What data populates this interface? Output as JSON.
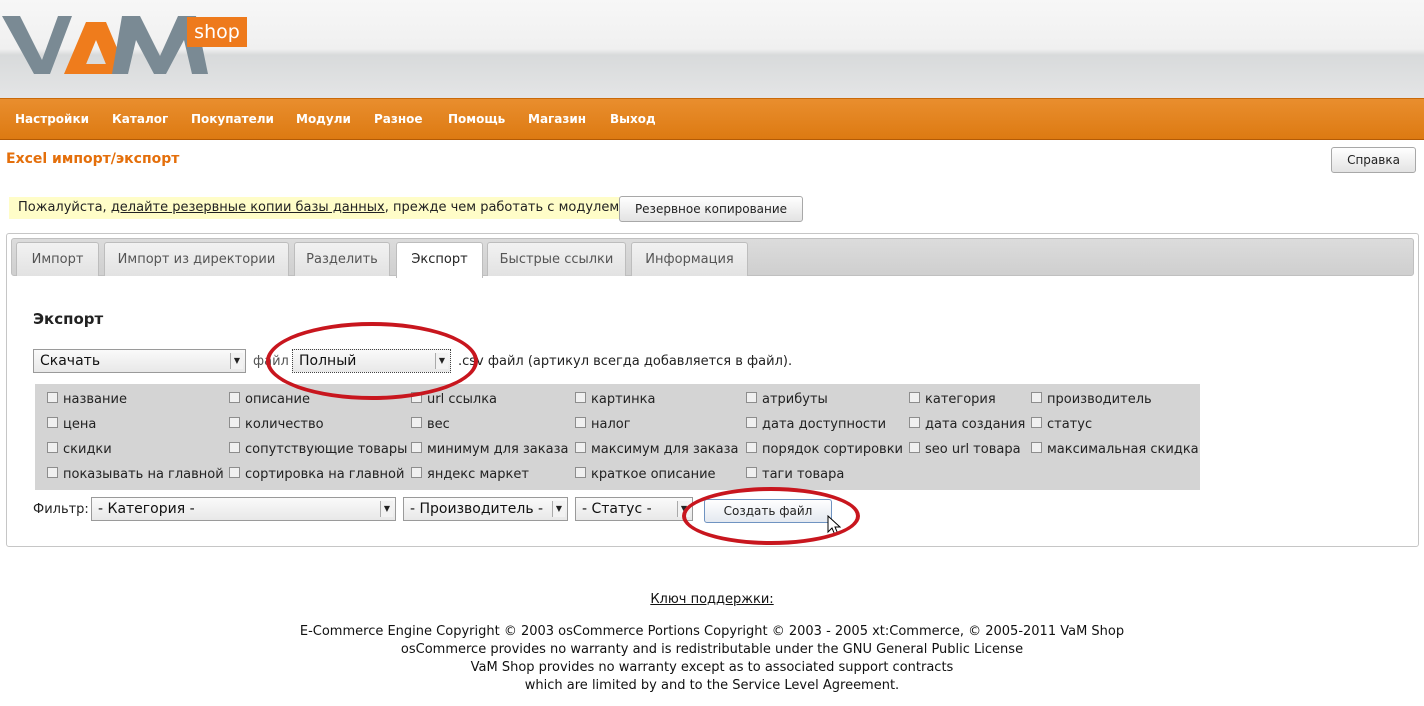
{
  "header": {
    "logo_text": "VaM",
    "logo_badge": "shop"
  },
  "nav": {
    "items": [
      {
        "label": "Настройки"
      },
      {
        "label": "Каталог"
      },
      {
        "label": "Покупатели"
      },
      {
        "label": "Модули"
      },
      {
        "label": "Разное"
      },
      {
        "label": "Помощь"
      },
      {
        "label": "Магазин"
      },
      {
        "label": "Выход"
      }
    ]
  },
  "page": {
    "title": "Excel импорт/экспорт",
    "help_label": "Справка"
  },
  "warning": {
    "prefix": "Пожалуйста, ",
    "link": "делайте резервные копии базы данных",
    "suffix": ", прежде чем работать с модулем!",
    "backup_button": "Резервное копирование"
  },
  "tabs": [
    {
      "label": "Импорт"
    },
    {
      "label": "Импорт из директории"
    },
    {
      "label": "Разделить"
    },
    {
      "label": "Экспорт",
      "active": true
    },
    {
      "label": "Быстрые ссылки"
    },
    {
      "label": "Информация"
    }
  ],
  "export": {
    "title": "Экспорт",
    "action_select": "Скачать",
    "file_word": "файл",
    "mode_select": "Полный",
    "mode_suffix": ".csv файл (артикул всегда добавляется в файл).",
    "fields": [
      "название",
      "описание",
      "url ссылка",
      "картинка",
      "атрибуты",
      "категория",
      "производитель",
      "цена",
      "количество",
      "вес",
      "налог",
      "дата доступности",
      "дата создания",
      "статус",
      "скидки",
      "сопутствующие товары",
      "минимум для заказа",
      "максимум для заказа",
      "порядок сортировки",
      "seo url товара",
      "максимальная скидка",
      "показывать на главной",
      "сортировка на главной",
      "яндекс маркет",
      "краткое описание",
      "таги товара"
    ],
    "filter_label": "Фильтр:",
    "filter_category": "- Категория -",
    "filter_manufacturer": "- Производитель -",
    "filter_status": "- Статус -",
    "create_button": "Создать файл"
  },
  "footer": {
    "support_key": "Ключ поддержки:",
    "line1": "E-Commerce Engine Copyright © 2003 osCommerce Portions Copyright © 2003 - 2005 xt:Commerce, © 2005-2011 VaM Shop",
    "line2": "osCommerce provides no warranty and is redistributable under the GNU General Public License",
    "line3": "VaM Shop provides no warranty except as to associated support contracts",
    "line4": "which are limited by and to the Service Level Agreement."
  },
  "colors": {
    "brand_orange": "#e46f0b",
    "logo_gray": "#7a8a94",
    "highlight_ellipse": "#c8161e"
  }
}
